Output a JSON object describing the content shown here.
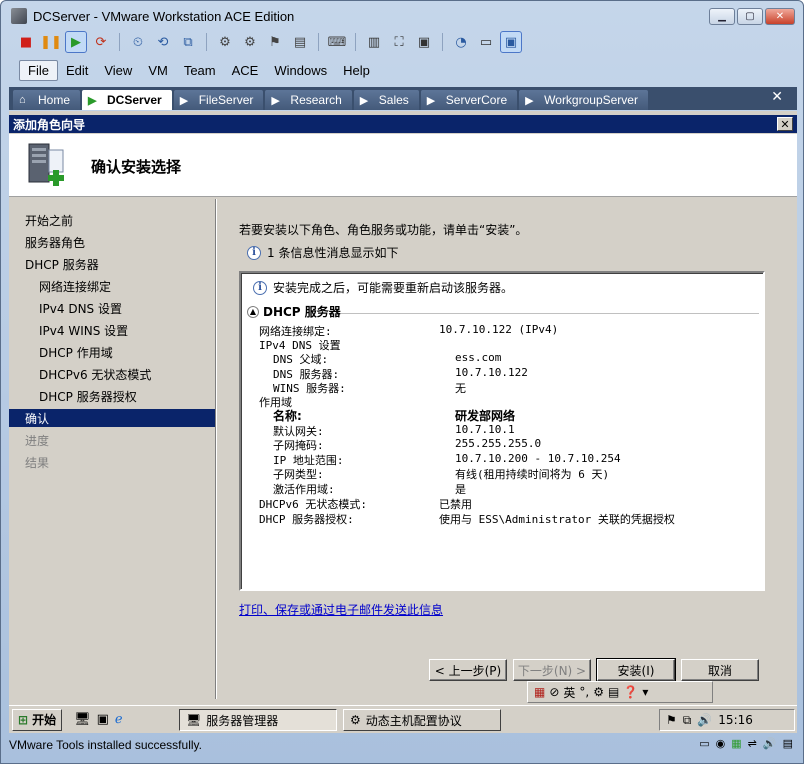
{
  "window": {
    "title": "DCServer - VMware Workstation ACE Edition"
  },
  "menu": [
    "File",
    "Edit",
    "View",
    "VM",
    "Team",
    "ACE",
    "Windows",
    "Help"
  ],
  "tabs": [
    "Home",
    "DCServer",
    "FileServer",
    "Research",
    "Sales",
    "ServerCore",
    "WorkgroupServer"
  ],
  "tabs_close": "✕",
  "wizard": {
    "title": "添加角色向导",
    "close": "✕",
    "header_title": "确认安装选择",
    "nav": [
      "开始之前",
      "服务器角色",
      "DHCP 服务器",
      "网络连接绑定",
      "IPv4 DNS 设置",
      "IPv4 WINS 设置",
      "DHCP 作用域",
      "DHCPv6 无状态模式",
      "DHCP 服务器授权",
      "确认",
      "进度",
      "结果"
    ],
    "instruction": "若要安装以下角色、角色服务或功能，请单击“安装”。",
    "info_count": "1 条信息性消息显示如下",
    "summary": {
      "note": "安装完成之后，可能需要重新启动该服务器。",
      "section": "DHCP 服务器",
      "rows": [
        {
          "label": "网络连接绑定:",
          "value": "10.7.10.122 (IPv4)"
        },
        {
          "label": "IPv4 DNS 设置",
          "value": ""
        },
        {
          "label": "DNS 父域:",
          "value": "ess.com"
        },
        {
          "label": "DNS 服务器:",
          "value": "10.7.10.122"
        },
        {
          "label": "WINS 服务器:",
          "value": "无"
        },
        {
          "label": "作用域",
          "value": ""
        },
        {
          "label": "名称:",
          "value": "研发部网络"
        },
        {
          "label": "默认网关:",
          "value": "10.7.10.1"
        },
        {
          "label": "子网掩码:",
          "value": "255.255.255.0"
        },
        {
          "label": "IP 地址范围:",
          "value": "10.7.10.200 - 10.7.10.254"
        },
        {
          "label": "子网类型:",
          "value": "有线(租用持续时间将为 6 天)"
        },
        {
          "label": "激活作用域:",
          "value": "是"
        },
        {
          "label": "DHCPv6 无状态模式:",
          "value": "已禁用"
        },
        {
          "label": "DHCP 服务器授权:",
          "value": "使用与 ESS\\Administrator 关联的凭据授权"
        }
      ]
    },
    "link": "打印、保存或通过电子邮件发送此信息",
    "buttons": {
      "prev": "< 上一步(P)",
      "next": "下一步(N) >",
      "install": "安装(I)",
      "cancel": "取消"
    }
  },
  "langbar": {
    "ime": "英"
  },
  "taskbar": {
    "start": "开始",
    "tasks": [
      "服务器管理器",
      "动态主机配置协议"
    ],
    "clock": "15:16"
  },
  "status": {
    "message": "VMware Tools installed successfully."
  },
  "colors": {
    "selection": "#0a246a",
    "tabbar": "#3a4f6d",
    "link": "#0000cc"
  }
}
